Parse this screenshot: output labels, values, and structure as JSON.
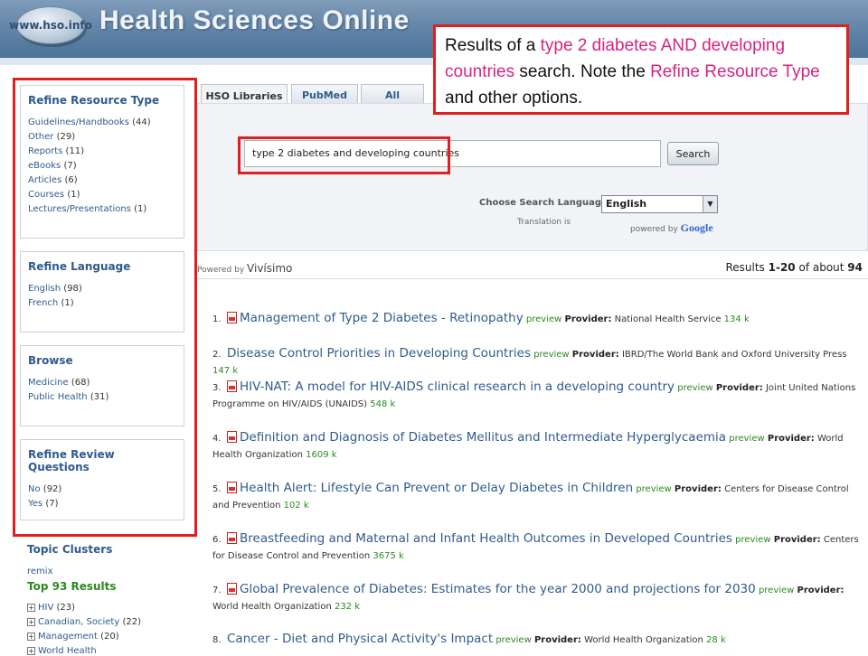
{
  "header": {
    "logo_text": "www.hso.info",
    "site_title": "Health Sciences Online"
  },
  "note": {
    "parts": [
      {
        "text": "Results of a ",
        "hl": false
      },
      {
        "text": "type 2 diabetes AND developing countries",
        "hl": true
      },
      {
        "text": " search. Note the ",
        "hl": false
      },
      {
        "text": "Refine Resource Type",
        "hl": true
      },
      {
        "text": " and other options.",
        "hl": false
      }
    ]
  },
  "tabs": [
    {
      "label": "HSO Libraries",
      "active": true
    },
    {
      "label": "PubMed",
      "active": false
    },
    {
      "label": "All",
      "active": false
    }
  ],
  "search": {
    "value": "type 2 diabetes and developing countries",
    "button": "Search",
    "language_label": "Choose Search Language:",
    "language_value": "English",
    "translation_text": "Translation is",
    "powered_by": "powered by",
    "google": "Google",
    "vivisimo": "Vivísimo",
    "powered_by_vivisimo": "Powered by"
  },
  "results_summary": {
    "prefix": "Results ",
    "range": "1-20",
    "mid": " of about ",
    "total": "94"
  },
  "sidebar": {
    "panels": [
      {
        "title": "Refine Resource Type",
        "items": [
          {
            "label": "Guidelines/Handbooks",
            "count": "(44)"
          },
          {
            "label": "Other",
            "count": "(29)"
          },
          {
            "label": "Reports",
            "count": "(11)"
          },
          {
            "label": "eBooks",
            "count": "(7)"
          },
          {
            "label": "Articles",
            "count": "(6)"
          },
          {
            "label": "Courses",
            "count": "(1)"
          },
          {
            "label": "Lectures/Presentations",
            "count": "(1)"
          }
        ]
      },
      {
        "title": "Refine Language",
        "items": [
          {
            "label": "English",
            "count": "(98)"
          },
          {
            "label": "French",
            "count": "(1)"
          }
        ]
      },
      {
        "title": "Browse",
        "items": [
          {
            "label": "Medicine",
            "count": "(68)"
          },
          {
            "label": "Public Health",
            "count": "(31)"
          }
        ]
      },
      {
        "title": "Refine Review Questions",
        "items": [
          {
            "label": "No",
            "count": "(92)"
          },
          {
            "label": "Yes",
            "count": "(7)"
          }
        ]
      }
    ],
    "topic_clusters": {
      "title": "Topic Clusters",
      "remix": "remix",
      "top": "Top 93 Results",
      "items": [
        {
          "label": "HIV",
          "count": "(23)"
        },
        {
          "label": "Canadian, Society",
          "count": "(22)"
        },
        {
          "label": "Management",
          "count": "(20)"
        },
        {
          "label": "World Health",
          "count": ""
        }
      ]
    }
  },
  "results": [
    {
      "num": "1.",
      "pdf": true,
      "title": "Management of Type 2 Diabetes - Retinopathy",
      "preview": "preview",
      "provider_label": "Provider:",
      "provider": "National Health Service",
      "size": "134 k"
    },
    {
      "num": "2.",
      "pdf": false,
      "title": "Disease Control Priorities in Developing Countries",
      "preview": "preview",
      "provider_label": "Provider:",
      "provider": "IBRD/The World Bank and Oxford University Press",
      "size": "147 k"
    },
    {
      "num": "3.",
      "pdf": true,
      "title": "HIV-NAT: A model for HIV-AIDS clinical research in a developing country",
      "preview": "preview",
      "provider_label": "Provider:",
      "provider": "Joint United Nations Programme on HIV/AIDS (UNAIDS)",
      "size": "548 k"
    },
    {
      "num": "4.",
      "pdf": true,
      "title": "Definition and Diagnosis of Diabetes Mellitus and Intermediate Hyperglycaemia",
      "preview": "preview",
      "provider_label": "Provider:",
      "provider": "World Health Organization",
      "size": "1609 k"
    },
    {
      "num": "5.",
      "pdf": true,
      "title": "Health Alert: Lifestyle Can Prevent or Delay Diabetes in Children",
      "preview": "preview",
      "provider_label": "Provider:",
      "provider": "Centers for Disease Control and Prevention",
      "size": "102 k"
    },
    {
      "num": "6.",
      "pdf": true,
      "title": "Breastfeeding and Maternal and Infant Health Outcomes in Developed Countries",
      "preview": "preview",
      "provider_label": "Provider:",
      "provider": "Centers for Disease Control and Prevention",
      "size": "3675 k"
    },
    {
      "num": "7.",
      "pdf": true,
      "title": "Global Prevalence of Diabetes: Estimates for the year 2000 and projections for 2030",
      "preview": "preview",
      "provider_label": "Provider:",
      "provider": "World Health Organization",
      "size": "232 k"
    },
    {
      "num": "8.",
      "pdf": false,
      "title": "Cancer - Diet and Physical Activity's Impact",
      "preview": "preview",
      "provider_label": "Provider:",
      "provider": "World Health Organization",
      "size": "28 k"
    }
  ],
  "colors": {
    "accent_red": "#e02020",
    "highlight": "#d8237f",
    "link": "#2f5b8c",
    "green": "#2b8a1f"
  }
}
